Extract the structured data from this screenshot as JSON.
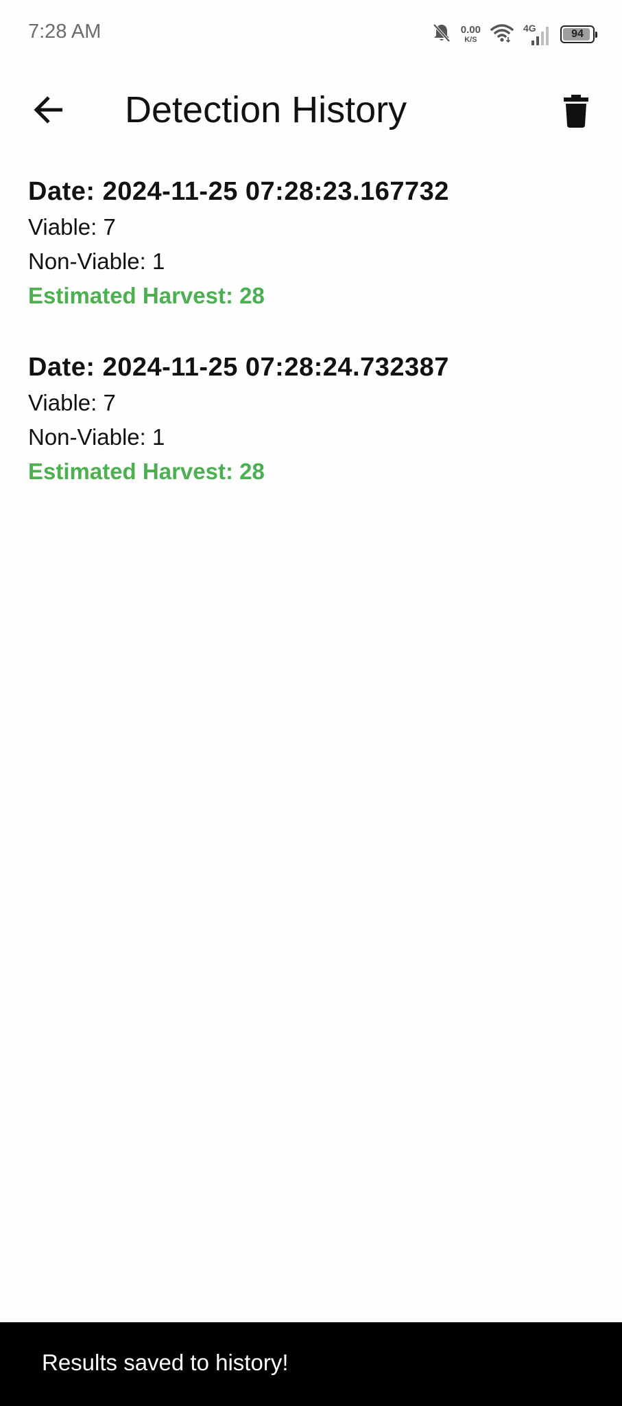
{
  "status_bar": {
    "time": "7:28 AM",
    "net_speed_value": "0.00",
    "net_speed_unit": "K/S",
    "network_type": "4G",
    "battery_level": "94",
    "icons": [
      "bell-off-icon",
      "wifi-icon",
      "cellular-signal-icon",
      "battery-icon"
    ]
  },
  "app_bar": {
    "title": "Detection History",
    "back_icon": "arrow-left-icon",
    "delete_icon": "trash-icon"
  },
  "history": [
    {
      "date": "Date: 2024-11-25 07:28:23.167732",
      "viable": "Viable: 7",
      "non_viable": "Non-Viable: 1",
      "harvest": "Estimated Harvest: 28"
    },
    {
      "date": "Date: 2024-11-25 07:28:24.732387",
      "viable": "Viable: 7",
      "non_viable": "Non-Viable: 1",
      "harvest": "Estimated Harvest: 28"
    }
  ],
  "snackbar": {
    "message": "Results saved to history!"
  },
  "colors": {
    "harvest_green": "#4caf50",
    "background": "#fefefe",
    "snackbar_bg": "#000000",
    "battery_level_fraction": 0.94
  }
}
